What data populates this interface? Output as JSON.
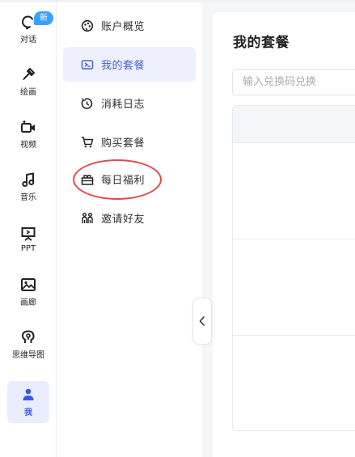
{
  "rail": {
    "items": [
      {
        "label": "对话",
        "icon": "chat-icon",
        "badge": "新"
      },
      {
        "label": "绘画",
        "icon": "brush-icon"
      },
      {
        "label": "视频",
        "icon": "video-icon"
      },
      {
        "label": "音乐",
        "icon": "music-icon"
      },
      {
        "label": "PPT",
        "icon": "ppt-icon"
      },
      {
        "label": "画廊",
        "icon": "image-icon"
      },
      {
        "label": "思维导图",
        "icon": "mindmap-icon"
      },
      {
        "label": "我",
        "icon": "user-icon",
        "active": true
      }
    ]
  },
  "menu": {
    "items": [
      {
        "label": "账户概览",
        "icon": "palette-icon"
      },
      {
        "label": "我的套餐",
        "icon": "ticket-icon",
        "active": true
      },
      {
        "label": "消耗日志",
        "icon": "clock-icon"
      },
      {
        "label": "购买套餐",
        "icon": "cart-icon"
      },
      {
        "label": "每日福利",
        "icon": "gift-icon"
      },
      {
        "label": "邀请好友",
        "icon": "people-icon"
      }
    ]
  },
  "main": {
    "title": "我的套餐",
    "redeem_placeholder": "输入兑换码兑换"
  },
  "colors": {
    "accent": "#4a61d6",
    "active_bg": "#eef1fd",
    "badge": "#3aa0ff",
    "annotation": "#e04b52"
  }
}
